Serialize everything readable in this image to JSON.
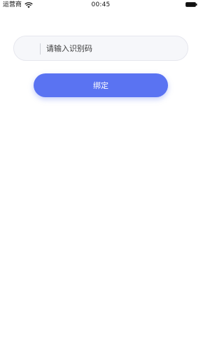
{
  "status_bar": {
    "carrier": "运营商",
    "time": "00:45",
    "wifi_icon": "wifi-icon",
    "battery_icon": "battery-icon"
  },
  "form": {
    "code_placeholder": "请输入识别码",
    "code_value": "",
    "bind_label": "绑定"
  },
  "colors": {
    "accent": "#5a73f2",
    "input_bg": "#f6f7fa"
  }
}
